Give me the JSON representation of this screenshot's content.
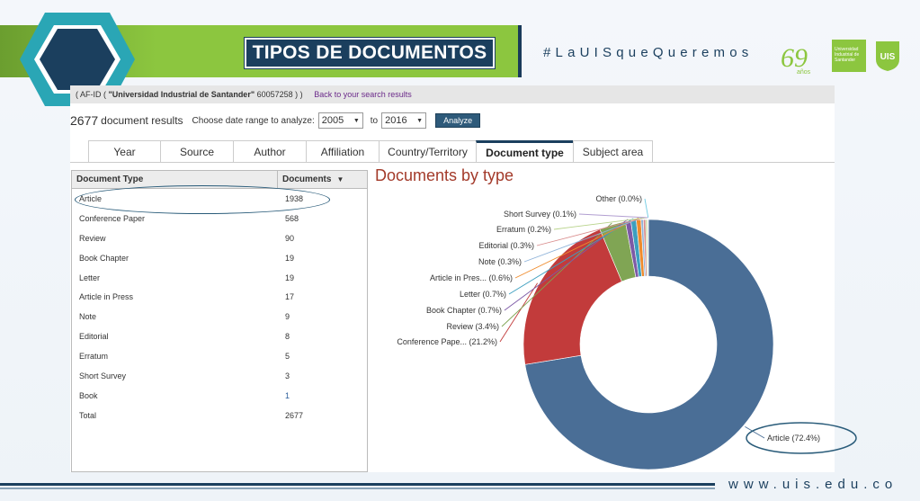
{
  "header": {
    "title": "TIPOS DE DOCUMENTOS",
    "hashtag": "#LaUISqueQueremos",
    "anniversary_number": "69",
    "anniversary_label": "años",
    "logo_text": "Universidad Industrial de Santander",
    "shield_text": "UIS"
  },
  "afid": {
    "prefix": "( AF-ID (",
    "name": "\"Universidad Industrial de Santander\"",
    "id": "60057258",
    "suffix": ") )",
    "back_link": "Back to your search results"
  },
  "results": {
    "count": "2677",
    "label": "document results",
    "range_label": "Choose date range to analyze:",
    "from_value": "2005",
    "to_label": "to",
    "to_value": "2016",
    "analyze_label": "Analyze"
  },
  "tabs": [
    {
      "label": "Year"
    },
    {
      "label": "Source"
    },
    {
      "label": "Author"
    },
    {
      "label": "Affiliation"
    },
    {
      "label": "Country/Territory"
    },
    {
      "label": "Document type",
      "active": true
    },
    {
      "label": "Subject area"
    }
  ],
  "table": {
    "col_type": "Document Type",
    "col_docs": "Documents",
    "rows": [
      {
        "type": "Article",
        "count": "1938"
      },
      {
        "type": "Conference Paper",
        "count": "568"
      },
      {
        "type": "Review",
        "count": "90"
      },
      {
        "type": "Book Chapter",
        "count": "19"
      },
      {
        "type": "Letter",
        "count": "19"
      },
      {
        "type": "Article in Press",
        "count": "17"
      },
      {
        "type": "Note",
        "count": "9"
      },
      {
        "type": "Editorial",
        "count": "8"
      },
      {
        "type": "Erratum",
        "count": "5"
      },
      {
        "type": "Short Survey",
        "count": "3"
      },
      {
        "type": "Book",
        "count": "1"
      },
      {
        "type": "Total",
        "count": "2677"
      }
    ]
  },
  "chart_data": {
    "type": "pie",
    "title": "Documents by type",
    "donut": true,
    "slices": [
      {
        "label": "Article (72.4%)",
        "value": 72.4,
        "color": "#4a6e96"
      },
      {
        "label": "Conference Pape... (21.2%)",
        "value": 21.2,
        "color": "#c23b3b"
      },
      {
        "label": "Review (3.4%)",
        "value": 3.4,
        "color": "#80a554"
      },
      {
        "label": "Book Chapter (0.7%)",
        "value": 0.7,
        "color": "#7d5aa6"
      },
      {
        "label": "Letter (0.7%)",
        "value": 0.7,
        "color": "#3d9fbf"
      },
      {
        "label": "Article in Pres... (0.6%)",
        "value": 0.6,
        "color": "#ef8b2c"
      },
      {
        "label": "Note (0.3%)",
        "value": 0.3,
        "color": "#8fb3d9"
      },
      {
        "label": "Editorial (0.3%)",
        "value": 0.3,
        "color": "#d98c8c"
      },
      {
        "label": "Erratum (0.2%)",
        "value": 0.2,
        "color": "#b8d38a"
      },
      {
        "label": "Short Survey (0.1%)",
        "value": 0.1,
        "color": "#b29fd1"
      },
      {
        "label": "Other (0.0%)",
        "value": 0.05,
        "color": "#6fcbe3"
      }
    ]
  },
  "colors": {
    "brand_dark": "#1b3f5e",
    "brand_green": "#8cc63f",
    "brand_teal": "#2aa6b5"
  },
  "footer": {
    "url": "www.uis.edu.co"
  }
}
